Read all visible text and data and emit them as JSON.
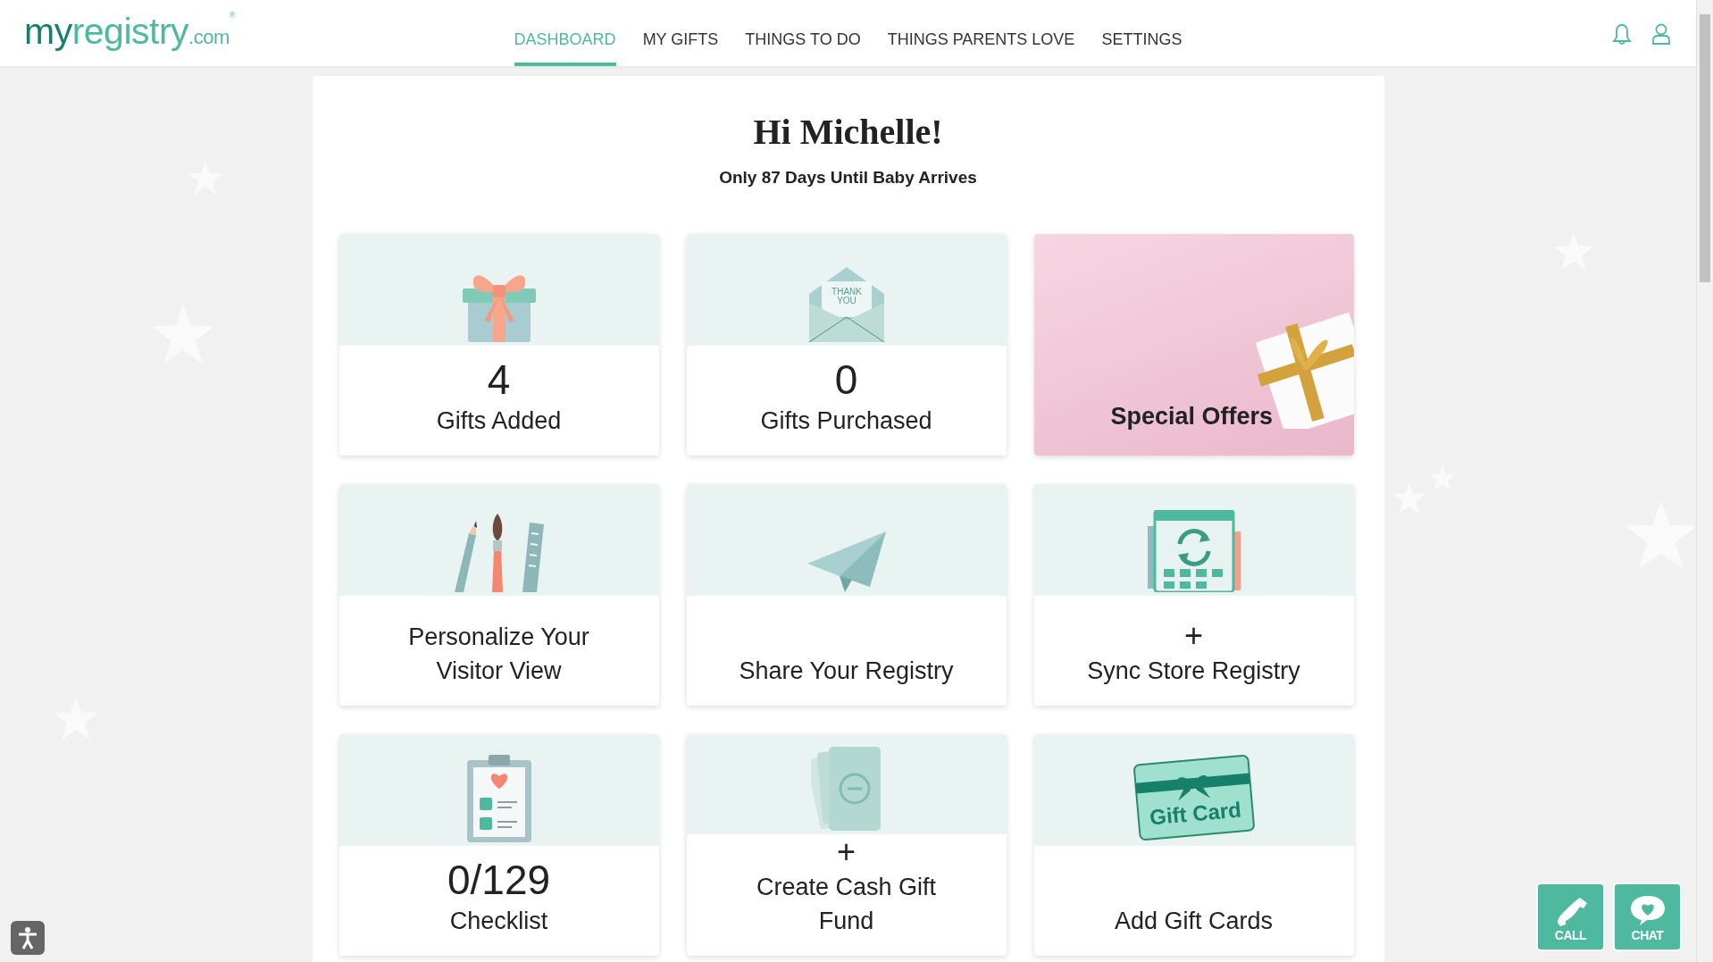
{
  "header": {
    "logo": {
      "first": "my",
      "second": "registry",
      "suffix": ".com",
      "mark": "®"
    },
    "nav": [
      {
        "label": "DASHBOARD",
        "selected": true
      },
      {
        "label": "MY GIFTS",
        "selected": false
      },
      {
        "label": "THINGS TO DO",
        "selected": false
      },
      {
        "label": "THINGS PARENTS LOVE",
        "selected": false
      },
      {
        "label": "SETTINGS",
        "selected": false
      }
    ]
  },
  "greeting": {
    "title": "Hi Michelle!",
    "subtitle": "Only 87 Days Until Baby Arrives"
  },
  "cards": [
    {
      "kind": "stat",
      "value": "4",
      "label": "Gifts Added"
    },
    {
      "kind": "stat",
      "value": "0",
      "label": "Gifts Purchased",
      "icon_text": "THANK YOU"
    },
    {
      "kind": "promo",
      "label": "Special Offers"
    },
    {
      "kind": "action",
      "label": "Personalize Your Visitor View"
    },
    {
      "kind": "action",
      "label": "Share Your Registry"
    },
    {
      "kind": "action",
      "prefix": "+",
      "label": "Sync Store Registry"
    },
    {
      "kind": "stat",
      "value": "0/129",
      "label": "Checklist"
    },
    {
      "kind": "action",
      "prefix": "+",
      "label": "Create Cash Gift Fund"
    },
    {
      "kind": "action",
      "label": "Add Gift Cards",
      "icon_text": "Gift Card"
    }
  ],
  "contact_buttons": [
    {
      "label": "CALL"
    },
    {
      "label": "CHAT"
    }
  ]
}
